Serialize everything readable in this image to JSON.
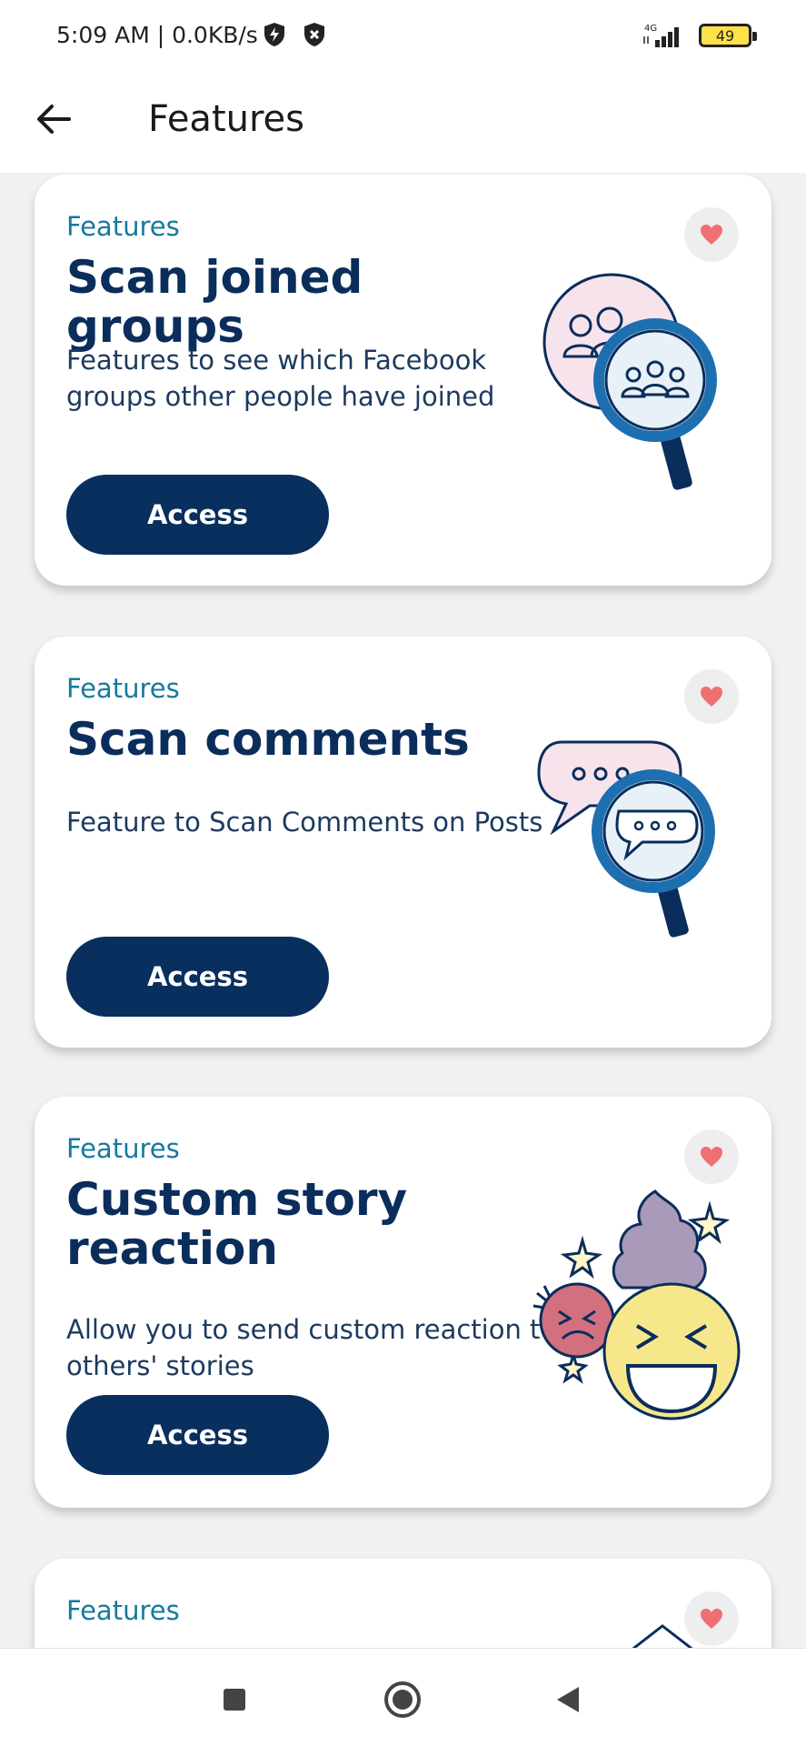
{
  "status_bar": {
    "time": "5:09 AM | 0.0KB/s",
    "network": "4G",
    "battery": "49"
  },
  "app_bar": {
    "title": "Features",
    "back_icon": "arrow-left-icon"
  },
  "cards": [
    {
      "label": "Features",
      "title": "Scan joined groups",
      "description": "Features to see which Facebook groups other people have joined",
      "button": "Access",
      "illustration": "group-search-illustration"
    },
    {
      "label": "Features",
      "title": "Scan comments",
      "description": "Feature to Scan Comments on Posts",
      "button": "Access",
      "illustration": "comment-search-illustration"
    },
    {
      "label": "Features",
      "title": "Custom story reaction",
      "description": "Allow you to send custom reaction to others' stories",
      "button": "Access",
      "illustration": "emoji-reaction-illustration"
    },
    {
      "label": "Features",
      "title": "",
      "description": "",
      "button": "",
      "illustration": "partial-illustration"
    }
  ],
  "nav_bar": {
    "items": [
      "square-icon",
      "home-circle-icon",
      "back-triangle-icon"
    ]
  },
  "colors": {
    "accent": "#17799e",
    "primary": "#082f5d",
    "heart": "#f06f72",
    "background": "#f1f1f1"
  }
}
